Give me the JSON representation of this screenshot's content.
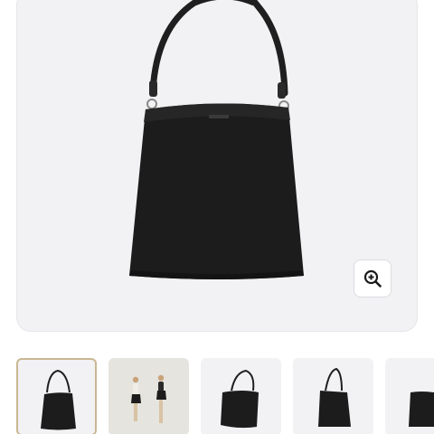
{
  "product_gallery": {
    "main_image": {
      "subject": "black-leather-bucket-tote-bag",
      "icon": "zoom-in-icon"
    },
    "zoom_button": {
      "icon": "zoom-in-icon"
    },
    "thumbnails": [
      {
        "view": "front",
        "selected": true
      },
      {
        "view": "model-front-and-back",
        "selected": false
      },
      {
        "view": "three-quarter",
        "selected": false
      },
      {
        "view": "side",
        "selected": false
      },
      {
        "view": "detail",
        "selected": false
      }
    ]
  },
  "colors": {
    "image_background": "#f2f2f4",
    "bag": "#1c1c1c",
    "selected_border": "#c9b792"
  }
}
